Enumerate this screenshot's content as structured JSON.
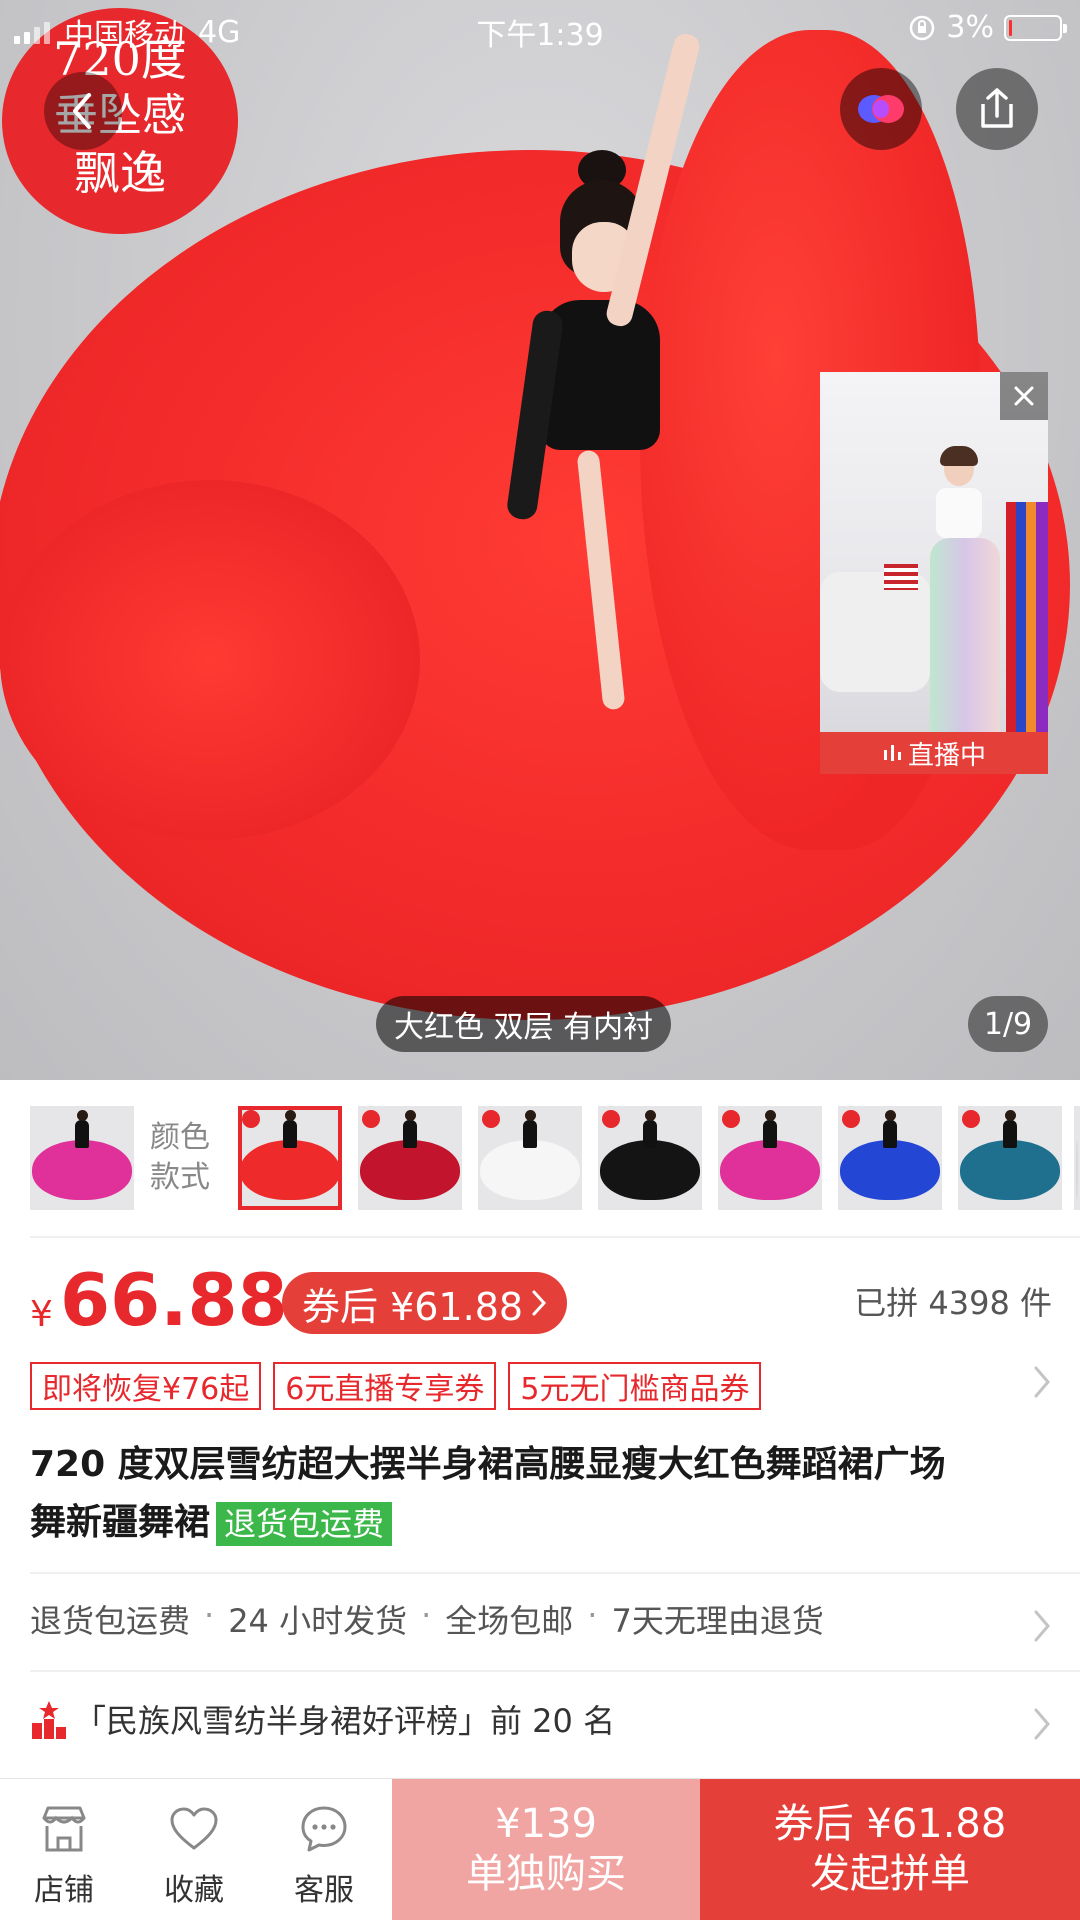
{
  "status_bar": {
    "carrier": "中国移动",
    "network": "4G",
    "time": "下午1:39",
    "battery": "3%"
  },
  "hero": {
    "promo_badge": [
      "720度",
      "垂坠感",
      "飘逸"
    ],
    "live_label": "直播中",
    "caption": "大红色 双层 有内衬",
    "counter": "1/9"
  },
  "swatches": {
    "label_line1": "颜色",
    "label_line2": "款式",
    "items": [
      {
        "name": "rose",
        "color": "#e0309a"
      },
      {
        "name": "red",
        "color": "#ee2a2a"
      },
      {
        "name": "wine",
        "color": "#c2142c"
      },
      {
        "name": "white",
        "color": "#f6f6f6"
      },
      {
        "name": "black",
        "color": "#141414"
      },
      {
        "name": "rose-2",
        "color": "#e0309a"
      },
      {
        "name": "blue",
        "color": "#2446d4"
      },
      {
        "name": "teal",
        "color": "#1f6f8e"
      },
      {
        "name": "more",
        "color": "#d8d8d8"
      }
    ]
  },
  "price": {
    "currency": "¥",
    "amount": "66.88",
    "coupon_price": "券后 ¥61.88",
    "sold": "已拼 4398 件"
  },
  "coupon_tags": [
    "即将恢复¥76起",
    "6元直播专享券",
    "5元无门槛商品券"
  ],
  "product": {
    "title_line1": "720 度双层雪纺超大摆半身裙高腰显瘦大红色舞蹈裙广场",
    "title_line2": "舞新疆舞裙",
    "title_tag": "退货包运费"
  },
  "services": [
    "退货包运费",
    "24 小时发货",
    "全场包邮",
    "7天无理由退货"
  ],
  "service_sep": "·",
  "ranking": "「民族风雪纺半身裙好评榜」前 20 名",
  "bottom_bar": {
    "store": "店铺",
    "favorite": "收藏",
    "service": "客服",
    "single_price": "¥139",
    "single_label": "单独购买",
    "group_price": "券后 ¥61.88",
    "group_label": "发起拼单"
  },
  "colors": {
    "accent": "#e7282c",
    "accent_light": "#f1a5a3",
    "green_tag": "#3cb84a"
  }
}
